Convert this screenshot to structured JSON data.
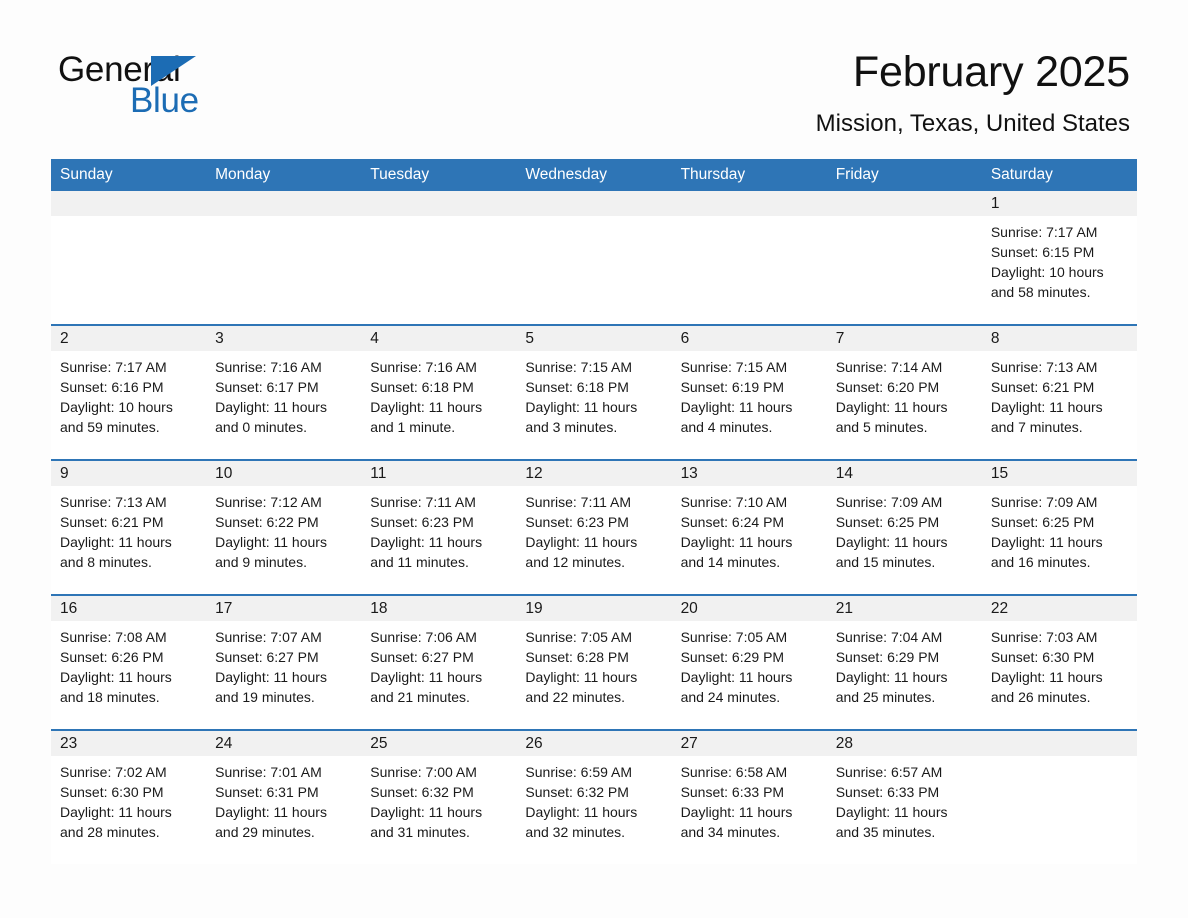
{
  "brand": {
    "name_part1": "General",
    "name_part2": "Blue",
    "accent_color": "#1c6cb4"
  },
  "header": {
    "month_title": "February 2025",
    "location": "Mission, Texas, United States"
  },
  "theme": {
    "header_blue": "#2e75b6",
    "daynum_band": "#f1f1f1",
    "text": "#1a1a1a"
  },
  "weekday_headers": [
    "Sunday",
    "Monday",
    "Tuesday",
    "Wednesday",
    "Thursday",
    "Friday",
    "Saturday"
  ],
  "weeks": [
    [
      {
        "blank": true
      },
      {
        "blank": true
      },
      {
        "blank": true
      },
      {
        "blank": true
      },
      {
        "blank": true
      },
      {
        "blank": true
      },
      {
        "blank": false,
        "day": "1",
        "sunrise": "Sunrise: 7:17 AM",
        "sunset": "Sunset: 6:15 PM",
        "daylight": "Daylight: 10 hours and 58 minutes."
      }
    ],
    [
      {
        "blank": false,
        "day": "2",
        "sunrise": "Sunrise: 7:17 AM",
        "sunset": "Sunset: 6:16 PM",
        "daylight": "Daylight: 10 hours and 59 minutes."
      },
      {
        "blank": false,
        "day": "3",
        "sunrise": "Sunrise: 7:16 AM",
        "sunset": "Sunset: 6:17 PM",
        "daylight": "Daylight: 11 hours and 0 minutes."
      },
      {
        "blank": false,
        "day": "4",
        "sunrise": "Sunrise: 7:16 AM",
        "sunset": "Sunset: 6:18 PM",
        "daylight": "Daylight: 11 hours and 1 minute."
      },
      {
        "blank": false,
        "day": "5",
        "sunrise": "Sunrise: 7:15 AM",
        "sunset": "Sunset: 6:18 PM",
        "daylight": "Daylight: 11 hours and 3 minutes."
      },
      {
        "blank": false,
        "day": "6",
        "sunrise": "Sunrise: 7:15 AM",
        "sunset": "Sunset: 6:19 PM",
        "daylight": "Daylight: 11 hours and 4 minutes."
      },
      {
        "blank": false,
        "day": "7",
        "sunrise": "Sunrise: 7:14 AM",
        "sunset": "Sunset: 6:20 PM",
        "daylight": "Daylight: 11 hours and 5 minutes."
      },
      {
        "blank": false,
        "day": "8",
        "sunrise": "Sunrise: 7:13 AM",
        "sunset": "Sunset: 6:21 PM",
        "daylight": "Daylight: 11 hours and 7 minutes."
      }
    ],
    [
      {
        "blank": false,
        "day": "9",
        "sunrise": "Sunrise: 7:13 AM",
        "sunset": "Sunset: 6:21 PM",
        "daylight": "Daylight: 11 hours and 8 minutes."
      },
      {
        "blank": false,
        "day": "10",
        "sunrise": "Sunrise: 7:12 AM",
        "sunset": "Sunset: 6:22 PM",
        "daylight": "Daylight: 11 hours and 9 minutes."
      },
      {
        "blank": false,
        "day": "11",
        "sunrise": "Sunrise: 7:11 AM",
        "sunset": "Sunset: 6:23 PM",
        "daylight": "Daylight: 11 hours and 11 minutes."
      },
      {
        "blank": false,
        "day": "12",
        "sunrise": "Sunrise: 7:11 AM",
        "sunset": "Sunset: 6:23 PM",
        "daylight": "Daylight: 11 hours and 12 minutes."
      },
      {
        "blank": false,
        "day": "13",
        "sunrise": "Sunrise: 7:10 AM",
        "sunset": "Sunset: 6:24 PM",
        "daylight": "Daylight: 11 hours and 14 minutes."
      },
      {
        "blank": false,
        "day": "14",
        "sunrise": "Sunrise: 7:09 AM",
        "sunset": "Sunset: 6:25 PM",
        "daylight": "Daylight: 11 hours and 15 minutes."
      },
      {
        "blank": false,
        "day": "15",
        "sunrise": "Sunrise: 7:09 AM",
        "sunset": "Sunset: 6:25 PM",
        "daylight": "Daylight: 11 hours and 16 minutes."
      }
    ],
    [
      {
        "blank": false,
        "day": "16",
        "sunrise": "Sunrise: 7:08 AM",
        "sunset": "Sunset: 6:26 PM",
        "daylight": "Daylight: 11 hours and 18 minutes."
      },
      {
        "blank": false,
        "day": "17",
        "sunrise": "Sunrise: 7:07 AM",
        "sunset": "Sunset: 6:27 PM",
        "daylight": "Daylight: 11 hours and 19 minutes."
      },
      {
        "blank": false,
        "day": "18",
        "sunrise": "Sunrise: 7:06 AM",
        "sunset": "Sunset: 6:27 PM",
        "daylight": "Daylight: 11 hours and 21 minutes."
      },
      {
        "blank": false,
        "day": "19",
        "sunrise": "Sunrise: 7:05 AM",
        "sunset": "Sunset: 6:28 PM",
        "daylight": "Daylight: 11 hours and 22 minutes."
      },
      {
        "blank": false,
        "day": "20",
        "sunrise": "Sunrise: 7:05 AM",
        "sunset": "Sunset: 6:29 PM",
        "daylight": "Daylight: 11 hours and 24 minutes."
      },
      {
        "blank": false,
        "day": "21",
        "sunrise": "Sunrise: 7:04 AM",
        "sunset": "Sunset: 6:29 PM",
        "daylight": "Daylight: 11 hours and 25 minutes."
      },
      {
        "blank": false,
        "day": "22",
        "sunrise": "Sunrise: 7:03 AM",
        "sunset": "Sunset: 6:30 PM",
        "daylight": "Daylight: 11 hours and 26 minutes."
      }
    ],
    [
      {
        "blank": false,
        "day": "23",
        "sunrise": "Sunrise: 7:02 AM",
        "sunset": "Sunset: 6:30 PM",
        "daylight": "Daylight: 11 hours and 28 minutes."
      },
      {
        "blank": false,
        "day": "24",
        "sunrise": "Sunrise: 7:01 AM",
        "sunset": "Sunset: 6:31 PM",
        "daylight": "Daylight: 11 hours and 29 minutes."
      },
      {
        "blank": false,
        "day": "25",
        "sunrise": "Sunrise: 7:00 AM",
        "sunset": "Sunset: 6:32 PM",
        "daylight": "Daylight: 11 hours and 31 minutes."
      },
      {
        "blank": false,
        "day": "26",
        "sunrise": "Sunrise: 6:59 AM",
        "sunset": "Sunset: 6:32 PM",
        "daylight": "Daylight: 11 hours and 32 minutes."
      },
      {
        "blank": false,
        "day": "27",
        "sunrise": "Sunrise: 6:58 AM",
        "sunset": "Sunset: 6:33 PM",
        "daylight": "Daylight: 11 hours and 34 minutes."
      },
      {
        "blank": false,
        "day": "28",
        "sunrise": "Sunrise: 6:57 AM",
        "sunset": "Sunset: 6:33 PM",
        "daylight": "Daylight: 11 hours and 35 minutes."
      },
      {
        "blank": true
      }
    ]
  ]
}
